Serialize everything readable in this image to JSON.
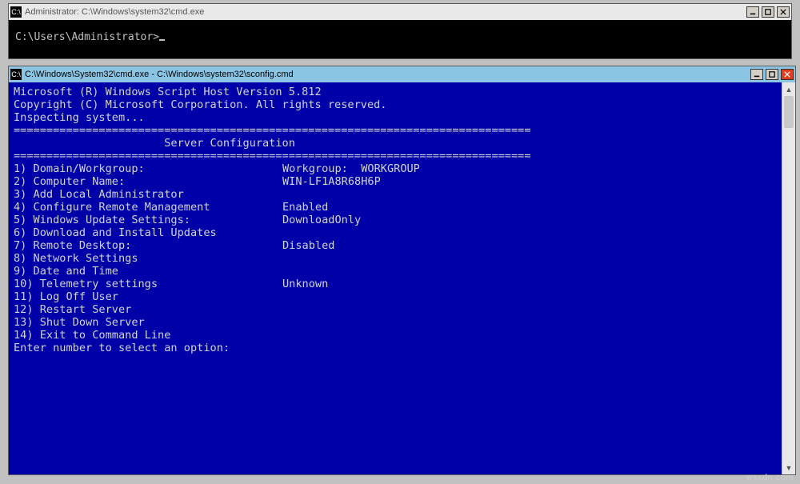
{
  "adminWindow": {
    "iconText": "C:\\",
    "title": "Administrator: C:\\Windows\\system32\\cmd.exe",
    "prompt": "C:\\Users\\Administrator>"
  },
  "sconfigWindow": {
    "iconText": "C:\\",
    "title": "C:\\Windows\\System32\\cmd.exe - C:\\Windows\\system32\\sconfig.cmd",
    "header1": "Microsoft (R) Windows Script Host Version 5.812",
    "header2": "Copyright (C) Microsoft Corporation. All rights reserved.",
    "inspecting": "Inspecting system...",
    "ruleline": "===============================================================================",
    "sectionTitle": "                       Server Configuration",
    "items": [
      {
        "n": "1",
        "label": "Domain/Workgroup:",
        "value": "Workgroup:  WORKGROUP"
      },
      {
        "n": "2",
        "label": "Computer Name:",
        "value": "WIN-LF1A8R68H6P"
      },
      {
        "n": "3",
        "label": "Add Local Administrator",
        "value": ""
      },
      {
        "n": "4",
        "label": "Configure Remote Management",
        "value": "Enabled"
      },
      {
        "n": "5",
        "label": "Windows Update Settings:",
        "value": "DownloadOnly"
      },
      {
        "n": "6",
        "label": "Download and Install Updates",
        "value": ""
      },
      {
        "n": "7",
        "label": "Remote Desktop:",
        "value": "Disabled"
      },
      {
        "n": "8",
        "label": "Network Settings",
        "value": ""
      },
      {
        "n": "9",
        "label": "Date and Time",
        "value": ""
      },
      {
        "n": "10",
        "label": "Telemetry settings",
        "value": "Unknown"
      },
      {
        "n": "11",
        "label": "Log Off User",
        "value": ""
      },
      {
        "n": "12",
        "label": "Restart Server",
        "value": ""
      },
      {
        "n": "13",
        "label": "Shut Down Server",
        "value": ""
      },
      {
        "n": "14",
        "label": "Exit to Command Line",
        "value": ""
      }
    ],
    "groupBreaksAfter": [
      "4",
      "7",
      "10"
    ],
    "groupBreaksBefore": [
      "1",
      "5",
      "8",
      "11"
    ],
    "footerPrompt": "Enter number to select an option:"
  },
  "watermark": "wsxdn.com"
}
